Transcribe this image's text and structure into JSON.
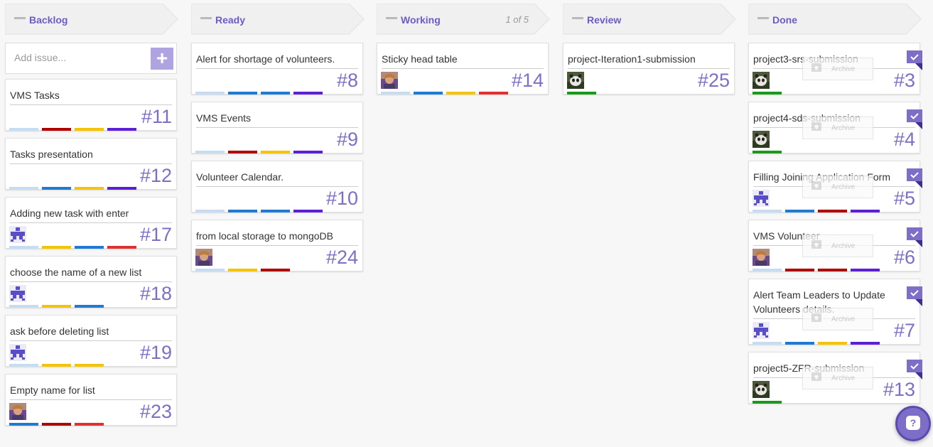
{
  "columns": [
    {
      "id": "backlog",
      "title": "Backlog",
      "count": "",
      "add_placeholder": "Add issue...",
      "cards": [
        {
          "title": "VMS Tasks",
          "num": "#11",
          "avatar": "",
          "labels": [
            "#c6dcf2",
            "#b00000",
            "#f5c400",
            "#5b1fd6"
          ]
        },
        {
          "title": "Tasks presentation",
          "num": "#12",
          "avatar": "",
          "labels": [
            "#c6dcf2",
            "#1f7ad4",
            "#f5c400",
            "#5b1fd6"
          ]
        },
        {
          "title": "Adding new task with enter",
          "num": "#17",
          "avatar": "pixel",
          "labels": [
            "#c6dcf2",
            "#f5c400",
            "#1f7ad4",
            "#e03030"
          ]
        },
        {
          "title": "choose the name of a new list",
          "num": "#18",
          "avatar": "pixel",
          "labels": [
            "#c6dcf2",
            "#f5c400",
            "#1f7ad4"
          ]
        },
        {
          "title": "ask before deleting list",
          "num": "#19",
          "avatar": "pixel",
          "labels": [
            "#c6dcf2",
            "#f5c400",
            "#f5c400"
          ]
        },
        {
          "title": "Empty name for list",
          "num": "#23",
          "avatar": "photo",
          "labels": [
            "#1f7ad4",
            "#b00000",
            "#e03030"
          ]
        }
      ]
    },
    {
      "id": "ready",
      "title": "Ready",
      "count": "",
      "cards": [
        {
          "title": "Alert for shortage of volunteers.",
          "num": "#8",
          "avatar": "",
          "labels": [
            "#c6dcf2",
            "#1f7ad4",
            "#1f7ad4",
            "#5b1fd6"
          ]
        },
        {
          "title": "VMS Events",
          "num": "#9",
          "avatar": "",
          "labels": [
            "#c6dcf2",
            "#b00000",
            "#f5c400",
            "#5b1fd6"
          ]
        },
        {
          "title": "Volunteer Calendar.",
          "num": "#10",
          "avatar": "",
          "labels": [
            "#c6dcf2",
            "#1f7ad4",
            "#1f7ad4",
            "#5b1fd6"
          ]
        },
        {
          "title": "from local storage to mongoDB",
          "num": "#24",
          "avatar": "photo",
          "labels": [
            "#c6dcf2",
            "#f5c400",
            "#b00000"
          ]
        }
      ]
    },
    {
      "id": "working",
      "title": "Working",
      "count": "1 of 5",
      "cards": [
        {
          "title": "Sticky head table",
          "num": "#14",
          "avatar": "photo",
          "labels": [
            "#c6dcf2",
            "#1f7ad4",
            "#f5c400",
            "#e03030"
          ]
        }
      ]
    },
    {
      "id": "review",
      "title": "Review",
      "count": "",
      "cards": [
        {
          "title": "project-Iteration1-submission",
          "num": "#25",
          "avatar": "panda",
          "labels": [
            "#1a9a1a"
          ]
        }
      ]
    },
    {
      "id": "done",
      "title": "Done",
      "count": "",
      "archive_label": "Archive",
      "cards": [
        {
          "title": "project3-srs-submission",
          "num": "#3",
          "avatar": "panda",
          "labels": [
            "#1a9a1a"
          ]
        },
        {
          "title": "project4-sds-submission",
          "num": "#4",
          "avatar": "panda",
          "labels": [
            "#1a9a1a"
          ]
        },
        {
          "title": "Filling Joining Application Form",
          "num": "#5",
          "avatar": "pixel",
          "labels": [
            "#c6dcf2",
            "#1f7ad4",
            "#b00000",
            "#5b1fd6"
          ]
        },
        {
          "title": "VMS Volunteer",
          "num": "#6",
          "avatar": "photo",
          "labels": [
            "#c6dcf2",
            "#b00000",
            "#b00000",
            "#5b1fd6"
          ]
        },
        {
          "title": "Alert Team Leaders to Update Volunteers details.",
          "num": "#7",
          "avatar": "pixel",
          "labels": [
            "#c6dcf2",
            "#1f7ad4",
            "#f5c400",
            "#5b1fd6"
          ]
        },
        {
          "title": "project5-ZFR-submission",
          "num": "#13",
          "avatar": "panda",
          "labels": [
            "#1a9a1a"
          ]
        }
      ]
    }
  ],
  "help": {
    "label": "?"
  },
  "colors": {
    "accent": "#7e6ec8",
    "header_bg": "#f0f0f0"
  }
}
